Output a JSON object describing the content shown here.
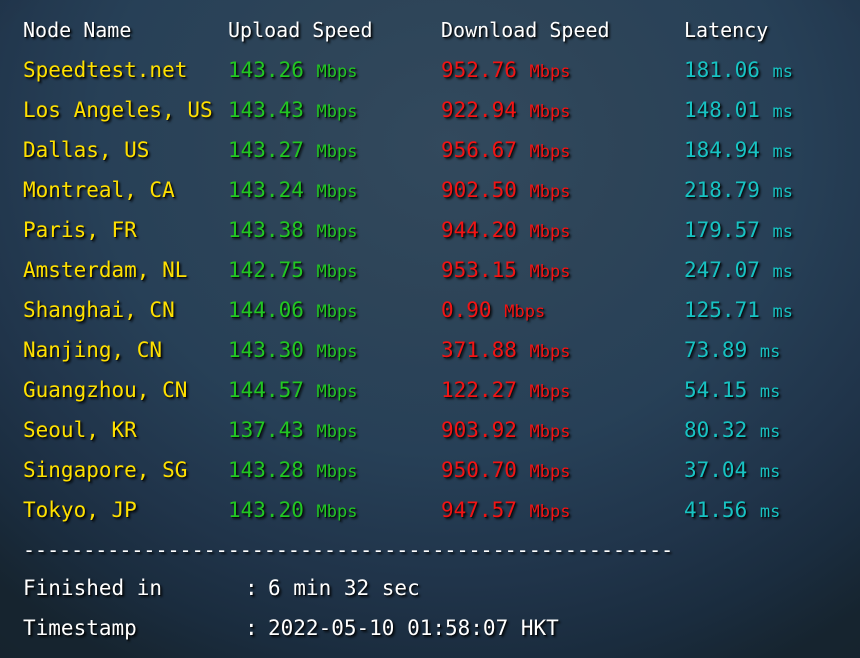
{
  "report": {
    "columns": {
      "node": "Node Name",
      "upload": "Upload Speed",
      "download": "Download Speed",
      "latency": "Latency"
    },
    "units": {
      "speed": "Mbps",
      "latency": "ms"
    },
    "separator": "------------------------------------------------------",
    "rows": [
      {
        "node": "Speedtest.net",
        "upload": "143.26",
        "download": "952.76",
        "latency": "181.06"
      },
      {
        "node": "Los Angeles, US",
        "upload": "143.43",
        "download": "922.94",
        "latency": "148.01"
      },
      {
        "node": "Dallas, US",
        "upload": "143.27",
        "download": "956.67",
        "latency": "184.94"
      },
      {
        "node": "Montreal, CA",
        "upload": "143.24",
        "download": "902.50",
        "latency": "218.79"
      },
      {
        "node": "Paris, FR",
        "upload": "143.38",
        "download": "944.20",
        "latency": "179.57"
      },
      {
        "node": "Amsterdam, NL",
        "upload": "142.75",
        "download": "953.15",
        "latency": "247.07"
      },
      {
        "node": "Shanghai, CN",
        "upload": "144.06",
        "download": "0.90",
        "latency": "125.71"
      },
      {
        "node": "Nanjing, CN",
        "upload": "143.30",
        "download": "371.88",
        "latency": "73.89"
      },
      {
        "node": "Guangzhou, CN",
        "upload": "144.57",
        "download": "122.27",
        "latency": "54.15"
      },
      {
        "node": "Seoul, KR",
        "upload": "137.43",
        "download": "903.92",
        "latency": "80.32"
      },
      {
        "node": "Singapore, SG",
        "upload": "143.28",
        "download": "950.70",
        "latency": "37.04"
      },
      {
        "node": "Tokyo, JP",
        "upload": "143.20",
        "download": "947.57",
        "latency": "41.56"
      }
    ],
    "summary": [
      {
        "label": "Finished in",
        "colon": ":",
        "value": "6 min 32 sec"
      },
      {
        "label": "Timestamp",
        "colon": ":",
        "value": "2022-05-10 01:58:07 HKT"
      }
    ]
  },
  "colors": {
    "node": "#ffe000",
    "upload": "#22c722",
    "download": "#f21414",
    "latency": "#18c3c3",
    "header": "#ffffff",
    "background": "#2d4458"
  }
}
